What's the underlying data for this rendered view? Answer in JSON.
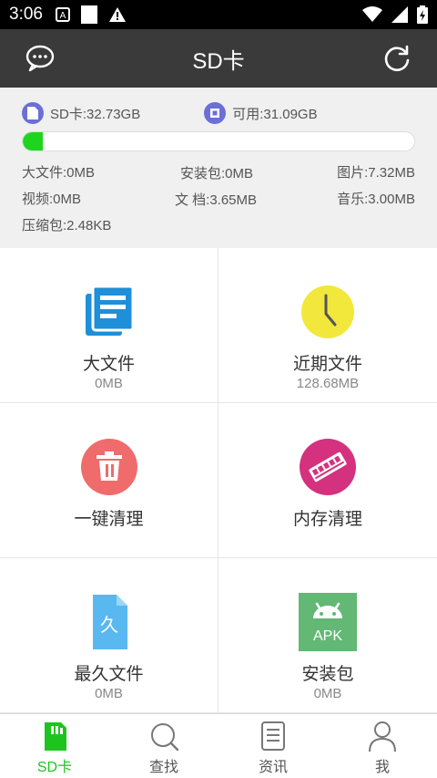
{
  "status_bar": {
    "time": "3:06"
  },
  "app_bar": {
    "title": "SD卡"
  },
  "storage": {
    "total": "SD卡:32.73GB",
    "available": "可用:31.09GB",
    "used_fraction": 0.05,
    "stats": {
      "large_files": "大文件:0MB",
      "packages": "安装包:0MB",
      "pictures": "图片:7.32MB",
      "videos": "视频:0MB",
      "documents": "文 档:3.65MB",
      "music": "音乐:3.00MB",
      "archives": "压缩包:2.48KB"
    }
  },
  "tiles": [
    {
      "label": "大文件",
      "sub": "0MB",
      "icon": "document-icon",
      "color": "#1e8fd8"
    },
    {
      "label": "近期文件",
      "sub": "128.68MB",
      "icon": "clock-icon",
      "color": "#f2e83c"
    },
    {
      "label": "一键清理",
      "sub": "",
      "icon": "trash-icon",
      "color": "#f06b6b"
    },
    {
      "label": "内存清理",
      "sub": "",
      "icon": "memory-chip-icon",
      "color": "#d4327e"
    },
    {
      "label": "最久文件",
      "sub": "0MB",
      "icon": "oldest-file-icon",
      "color": "#5ab8f0",
      "glyph": "久"
    },
    {
      "label": "安装包",
      "sub": "0MB",
      "icon": "android-apk-icon",
      "color": "#62b874",
      "glyph": "APK"
    }
  ],
  "bottom_nav": [
    {
      "label": "SD卡",
      "icon": "sd-card-icon",
      "active": true
    },
    {
      "label": "查找",
      "icon": "search-icon",
      "active": false
    },
    {
      "label": "资讯",
      "icon": "news-icon",
      "active": false
    },
    {
      "label": "我",
      "icon": "person-icon",
      "active": false
    }
  ],
  "colors": {
    "accent": "#1ec41e",
    "app_bar": "#3a3a3a",
    "progress": "#1ed41e",
    "capacity_icon": "#6b6fd6"
  }
}
